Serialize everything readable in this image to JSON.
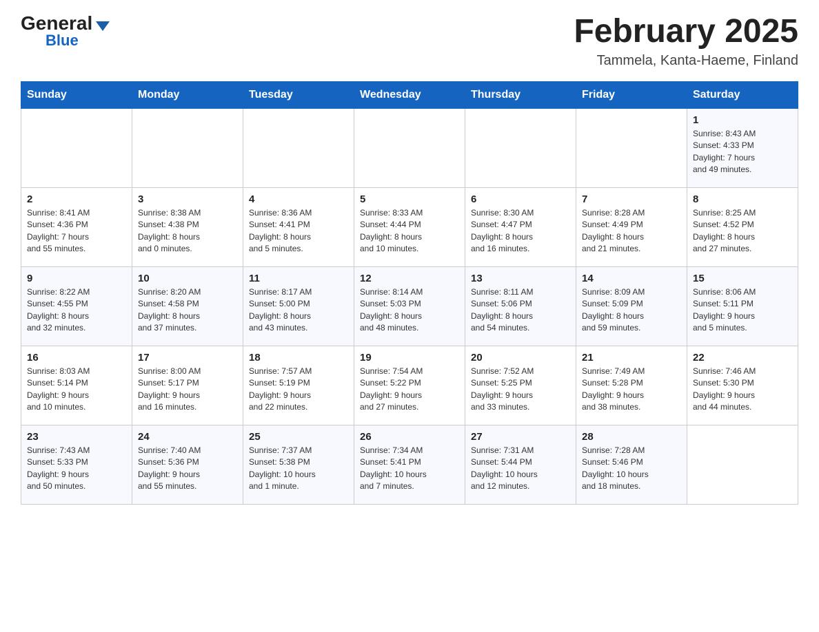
{
  "header": {
    "logo_general": "General",
    "logo_blue": "Blue",
    "month_title": "February 2025",
    "location": "Tammela, Kanta-Haeme, Finland"
  },
  "days_of_week": [
    "Sunday",
    "Monday",
    "Tuesday",
    "Wednesday",
    "Thursday",
    "Friday",
    "Saturday"
  ],
  "weeks": [
    [
      {
        "day": "",
        "info": ""
      },
      {
        "day": "",
        "info": ""
      },
      {
        "day": "",
        "info": ""
      },
      {
        "day": "",
        "info": ""
      },
      {
        "day": "",
        "info": ""
      },
      {
        "day": "",
        "info": ""
      },
      {
        "day": "1",
        "info": "Sunrise: 8:43 AM\nSunset: 4:33 PM\nDaylight: 7 hours\nand 49 minutes."
      }
    ],
    [
      {
        "day": "2",
        "info": "Sunrise: 8:41 AM\nSunset: 4:36 PM\nDaylight: 7 hours\nand 55 minutes."
      },
      {
        "day": "3",
        "info": "Sunrise: 8:38 AM\nSunset: 4:38 PM\nDaylight: 8 hours\nand 0 minutes."
      },
      {
        "day": "4",
        "info": "Sunrise: 8:36 AM\nSunset: 4:41 PM\nDaylight: 8 hours\nand 5 minutes."
      },
      {
        "day": "5",
        "info": "Sunrise: 8:33 AM\nSunset: 4:44 PM\nDaylight: 8 hours\nand 10 minutes."
      },
      {
        "day": "6",
        "info": "Sunrise: 8:30 AM\nSunset: 4:47 PM\nDaylight: 8 hours\nand 16 minutes."
      },
      {
        "day": "7",
        "info": "Sunrise: 8:28 AM\nSunset: 4:49 PM\nDaylight: 8 hours\nand 21 minutes."
      },
      {
        "day": "8",
        "info": "Sunrise: 8:25 AM\nSunset: 4:52 PM\nDaylight: 8 hours\nand 27 minutes."
      }
    ],
    [
      {
        "day": "9",
        "info": "Sunrise: 8:22 AM\nSunset: 4:55 PM\nDaylight: 8 hours\nand 32 minutes."
      },
      {
        "day": "10",
        "info": "Sunrise: 8:20 AM\nSunset: 4:58 PM\nDaylight: 8 hours\nand 37 minutes."
      },
      {
        "day": "11",
        "info": "Sunrise: 8:17 AM\nSunset: 5:00 PM\nDaylight: 8 hours\nand 43 minutes."
      },
      {
        "day": "12",
        "info": "Sunrise: 8:14 AM\nSunset: 5:03 PM\nDaylight: 8 hours\nand 48 minutes."
      },
      {
        "day": "13",
        "info": "Sunrise: 8:11 AM\nSunset: 5:06 PM\nDaylight: 8 hours\nand 54 minutes."
      },
      {
        "day": "14",
        "info": "Sunrise: 8:09 AM\nSunset: 5:09 PM\nDaylight: 8 hours\nand 59 minutes."
      },
      {
        "day": "15",
        "info": "Sunrise: 8:06 AM\nSunset: 5:11 PM\nDaylight: 9 hours\nand 5 minutes."
      }
    ],
    [
      {
        "day": "16",
        "info": "Sunrise: 8:03 AM\nSunset: 5:14 PM\nDaylight: 9 hours\nand 10 minutes."
      },
      {
        "day": "17",
        "info": "Sunrise: 8:00 AM\nSunset: 5:17 PM\nDaylight: 9 hours\nand 16 minutes."
      },
      {
        "day": "18",
        "info": "Sunrise: 7:57 AM\nSunset: 5:19 PM\nDaylight: 9 hours\nand 22 minutes."
      },
      {
        "day": "19",
        "info": "Sunrise: 7:54 AM\nSunset: 5:22 PM\nDaylight: 9 hours\nand 27 minutes."
      },
      {
        "day": "20",
        "info": "Sunrise: 7:52 AM\nSunset: 5:25 PM\nDaylight: 9 hours\nand 33 minutes."
      },
      {
        "day": "21",
        "info": "Sunrise: 7:49 AM\nSunset: 5:28 PM\nDaylight: 9 hours\nand 38 minutes."
      },
      {
        "day": "22",
        "info": "Sunrise: 7:46 AM\nSunset: 5:30 PM\nDaylight: 9 hours\nand 44 minutes."
      }
    ],
    [
      {
        "day": "23",
        "info": "Sunrise: 7:43 AM\nSunset: 5:33 PM\nDaylight: 9 hours\nand 50 minutes."
      },
      {
        "day": "24",
        "info": "Sunrise: 7:40 AM\nSunset: 5:36 PM\nDaylight: 9 hours\nand 55 minutes."
      },
      {
        "day": "25",
        "info": "Sunrise: 7:37 AM\nSunset: 5:38 PM\nDaylight: 10 hours\nand 1 minute."
      },
      {
        "day": "26",
        "info": "Sunrise: 7:34 AM\nSunset: 5:41 PM\nDaylight: 10 hours\nand 7 minutes."
      },
      {
        "day": "27",
        "info": "Sunrise: 7:31 AM\nSunset: 5:44 PM\nDaylight: 10 hours\nand 12 minutes."
      },
      {
        "day": "28",
        "info": "Sunrise: 7:28 AM\nSunset: 5:46 PM\nDaylight: 10 hours\nand 18 minutes."
      },
      {
        "day": "",
        "info": ""
      }
    ]
  ]
}
